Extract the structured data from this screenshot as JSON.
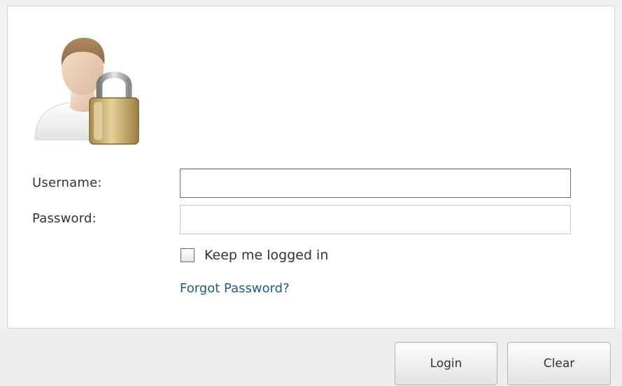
{
  "form": {
    "icon": "user-lock-icon",
    "username_label": "Username:",
    "password_label": "Password:",
    "username_value": "",
    "password_value": "",
    "keep_logged_in_label": "Keep me logged in",
    "keep_logged_in_checked": false,
    "forgot_password_link": "Forgot Password?"
  },
  "actions": {
    "login_label": "Login",
    "clear_label": "Clear"
  },
  "colors": {
    "link": "#1f5b86",
    "panel_background": "#ffffff",
    "footer_background": "#eeeeee"
  }
}
